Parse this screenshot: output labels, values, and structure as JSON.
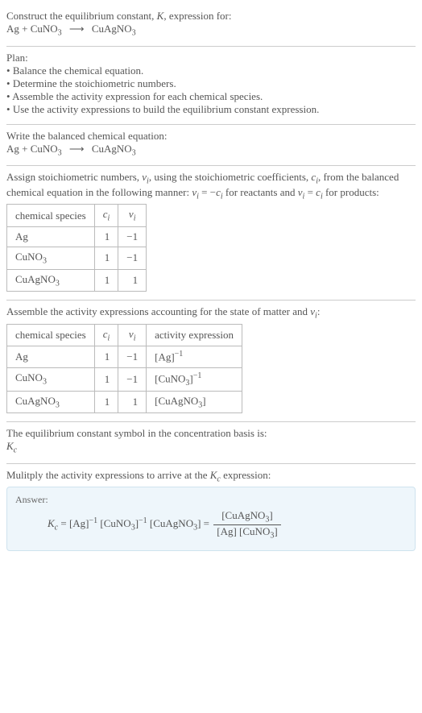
{
  "header": {
    "prompt": "Construct the equilibrium constant, ",
    "Ksym": "K",
    "prompt2": ", expression for:",
    "eq_lhs1": "Ag + CuNO",
    "eq_lhs1_sub": "3",
    "eq_arrow": "⟶",
    "eq_rhs1": "CuAgNO",
    "eq_rhs1_sub": "3"
  },
  "plan": {
    "title": "Plan:",
    "items": [
      "Balance the chemical equation.",
      "Determine the stoichiometric numbers.",
      "Assemble the activity expression for each chemical species.",
      "Use the activity expressions to build the equilibrium constant expression."
    ]
  },
  "balanced": {
    "title": "Write the balanced chemical equation:",
    "lhs1": "Ag + CuNO",
    "lhs1_sub": "3",
    "arrow": "⟶",
    "rhs1": "CuAgNO",
    "rhs1_sub": "3"
  },
  "stoich": {
    "intro1": "Assign stoichiometric numbers, ",
    "nu": "ν",
    "i": "i",
    "intro2": ", using the stoichiometric coefficients, ",
    "c": "c",
    "intro3": ", from the balanced chemical equation in the following manner: ",
    "rel1a": "ν",
    "rel1b": " = −",
    "rel1c": "c",
    "rel_txt1": " for reactants and ",
    "rel2a": "ν",
    "rel2b": " = ",
    "rel2c": "c",
    "rel_txt2": " for products:",
    "headers": {
      "species": "chemical species",
      "c": "c",
      "nu": "ν",
      "i": "i"
    },
    "rows": [
      {
        "species": "Ag",
        "c": "1",
        "nu": "−1"
      },
      {
        "species_base": "CuNO",
        "species_sub": "3",
        "c": "1",
        "nu": "−1"
      },
      {
        "species_base": "CuAgNO",
        "species_sub": "3",
        "c": "1",
        "nu": "1"
      }
    ]
  },
  "activity": {
    "intro": "Assemble the activity expressions accounting for the state of matter and ",
    "nu": "ν",
    "i": "i",
    "colon": ":",
    "headers": {
      "species": "chemical species",
      "c": "c",
      "nu": "ν",
      "i": "i",
      "act": "activity expression"
    },
    "rows": [
      {
        "species": "Ag",
        "c": "1",
        "nu": "−1",
        "act_base": "[Ag]",
        "act_exp": "−1"
      },
      {
        "species_base": "CuNO",
        "species_sub": "3",
        "c": "1",
        "nu": "−1",
        "act_base1": "[CuNO",
        "act_sub": "3",
        "act_base2": "]",
        "act_exp": "−1"
      },
      {
        "species_base": "CuAgNO",
        "species_sub": "3",
        "c": "1",
        "nu": "1",
        "act_base1": "[CuAgNO",
        "act_sub": "3",
        "act_base2": "]"
      }
    ]
  },
  "symboltext": {
    "line": "The equilibrium constant symbol in the concentration basis is:",
    "K": "K",
    "c": "c"
  },
  "multiply": {
    "line1": "Mulitply the activity expressions to arrive at the ",
    "K": "K",
    "c": "c",
    "line2": " expression:"
  },
  "answer": {
    "label": "Answer:",
    "K": "K",
    "c": "c",
    "eq": " = ",
    "t1": "[Ag]",
    "e1": "−1",
    "t2a": " [CuNO",
    "t2sub": "3",
    "t2b": "]",
    "e2": "−1",
    "t3a": " [CuAgNO",
    "t3sub": "3",
    "t3b": "] = ",
    "num_a": "[CuAgNO",
    "num_sub": "3",
    "num_b": "]",
    "den_a": "[Ag] [CuNO",
    "den_sub": "3",
    "den_b": "]"
  }
}
